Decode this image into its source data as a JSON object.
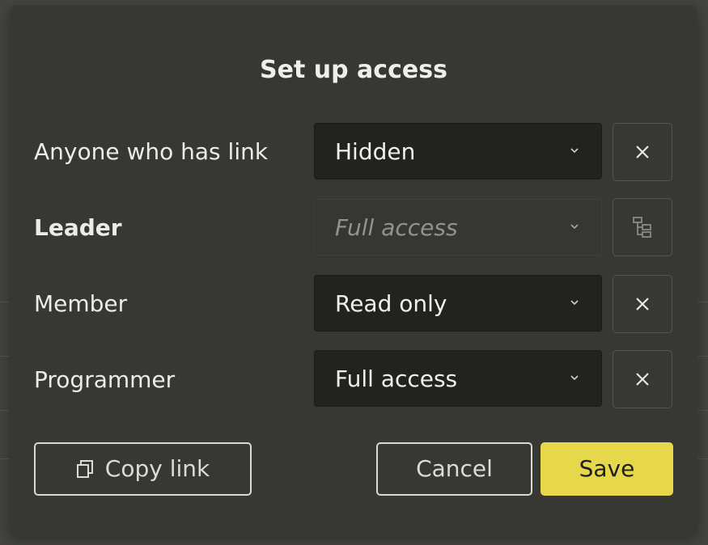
{
  "dialog": {
    "title": "Set up access",
    "rows": [
      {
        "label": "Anyone who has link",
        "value": "Hidden",
        "action_icon": "close-icon"
      },
      {
        "label": "Leader",
        "value": "Full access",
        "action_icon": "hierarchy-icon"
      },
      {
        "label": "Member",
        "value": "Read only",
        "action_icon": "close-icon"
      },
      {
        "label": "Programmer",
        "value": "Full access",
        "action_icon": "close-icon"
      }
    ],
    "copy_link_label": "Copy link",
    "cancel_label": "Cancel",
    "save_label": "Save"
  },
  "colors": {
    "accent": "#e6d84a",
    "dialog_bg": "#373733",
    "select_bg": "#222221"
  }
}
